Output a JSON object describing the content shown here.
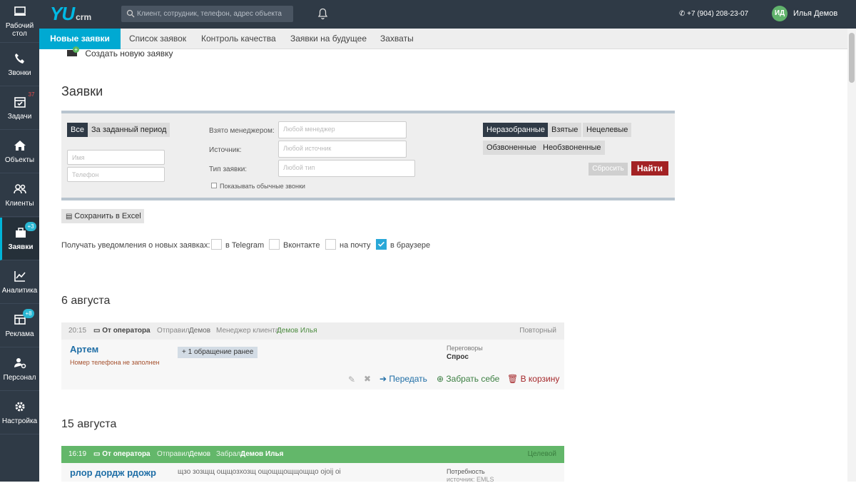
{
  "header": {
    "logo": "YU",
    "logo_suffix": "crm",
    "search_placeholder": "Клиент, сотрудник, телефон, адрес объекта",
    "phone": "+7 (904) 208-23-07",
    "user_initials": "ИД",
    "user_name": "Илья Демов"
  },
  "sidebar": {
    "items": [
      {
        "label": "Рабочий стол",
        "icon": "monitor-icon"
      },
      {
        "label": "Звонки",
        "icon": "phone-icon"
      },
      {
        "label": "Задачи",
        "icon": "calendar-icon",
        "badge": "37"
      },
      {
        "label": "Объекты",
        "icon": "home-icon"
      },
      {
        "label": "Клиенты",
        "icon": "users-icon"
      },
      {
        "label": "Заявки",
        "icon": "briefcase-icon",
        "badge": "+3"
      },
      {
        "label": "Аналитика",
        "icon": "chart-icon"
      },
      {
        "label": "Реклама",
        "icon": "ad-icon",
        "badge": "+8"
      },
      {
        "label": "Персонал",
        "icon": "staff-icon"
      },
      {
        "label": "Настройка",
        "icon": "gear-icon"
      }
    ]
  },
  "tabs": [
    "Новые заявки",
    "Список заявок",
    "Контроль качества",
    "Заявки на будущее",
    "Захваты"
  ],
  "create_label": "Создать новую заявку",
  "page_title": "Заявки",
  "filter": {
    "all": "Все",
    "period": "За заданный период",
    "name_placeholder": "Имя",
    "phone_placeholder": "Телефон",
    "manager_label": "Взято менеджером:",
    "manager_placeholder": "Любой менеджер",
    "source_label": "Источник:",
    "source_placeholder": "Любой источник",
    "type_label": "Тип заявки:",
    "type_placeholder": "Любой тип",
    "show_calls": "Показывать обычные звонки",
    "statuses": [
      "Неразобранные",
      "Взятые",
      "Нецелевые",
      "Обзвоненные",
      "Необзвоненные"
    ],
    "reset": "Сбросить",
    "find": "Найти"
  },
  "excel": "Сохранить в Excel",
  "notifications": {
    "label": "Получать уведомления о новых заявках:",
    "options": [
      {
        "label": "в Telegram",
        "checked": false
      },
      {
        "label": "Вконтакте",
        "checked": false
      },
      {
        "label": "на почту",
        "checked": false
      },
      {
        "label": "в браузере",
        "checked": true
      }
    ]
  },
  "groups": [
    {
      "date": "6 августа",
      "card": {
        "time": "20:15",
        "from": "От оператора",
        "sent_label": "Отправил:",
        "sent_by": "Демов",
        "manager_label": "Менеджер клиента:",
        "manager": "Демов Илья",
        "status": "Повторный",
        "client": "Артем",
        "phone_note": "Номер телефона не заполнен",
        "prev": "+ 1 обращение ранее",
        "stage": "Переговоры",
        "kind": "Спрос",
        "actions": [
          "Передать",
          "Забрать себе",
          "В корзину"
        ]
      }
    },
    {
      "date": "15 августа",
      "card": {
        "time": "16:19",
        "from": "От оператора",
        "sent_label": "Отправил:",
        "sent_by": "Демов",
        "taken_label": "Забрал:",
        "taken_by": "Демов Илья",
        "status": "Целевой",
        "client": "рлор дордж рдожр",
        "comment": "щзо зозщщ ощщозхозщ ощощщощщощщо оjоij оi",
        "need": "Потребность",
        "source": "источник: EMLS"
      }
    }
  ]
}
